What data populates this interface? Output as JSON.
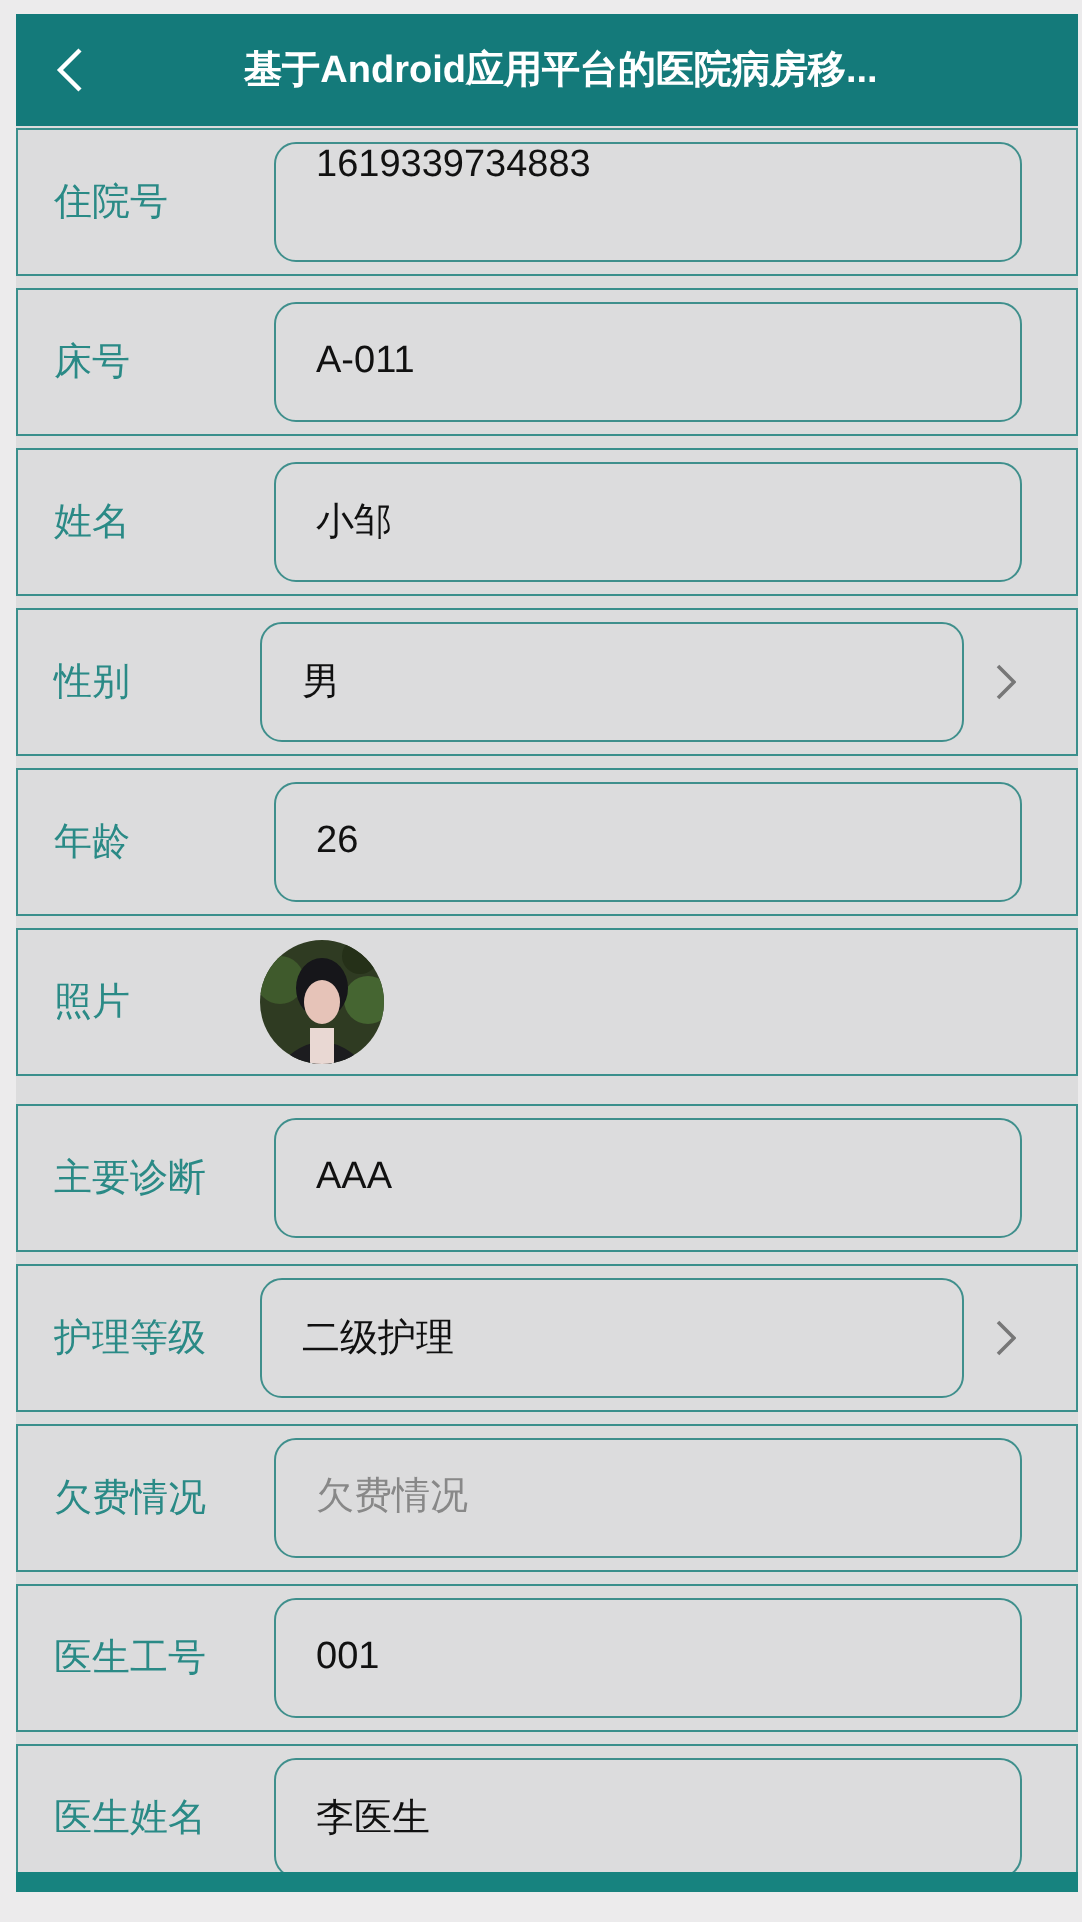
{
  "header": {
    "title": "基于Android应用平台的医院病房移..."
  },
  "fields": [
    {
      "kind": "textarea",
      "label": "住院号",
      "value": "1619339734883"
    },
    {
      "kind": "input",
      "label": "床号",
      "value": "A-011"
    },
    {
      "kind": "input",
      "label": "姓名",
      "value": "小邹"
    },
    {
      "kind": "select",
      "label": "性别",
      "value": "男"
    },
    {
      "kind": "input",
      "label": "年龄",
      "value": "26"
    },
    {
      "label": "照片"
    },
    {
      "kind": "input",
      "label": "主要诊断",
      "value": "AAA"
    },
    {
      "kind": "select",
      "label": "护理等级",
      "value": "二级护理"
    },
    {
      "kind": "input",
      "label": "欠费情况",
      "placeholder": "欠费情况"
    },
    {
      "kind": "input",
      "label": "医生工号",
      "value": "001"
    },
    {
      "kind": "input",
      "label": "医生姓名",
      "value": "李医生"
    }
  ]
}
